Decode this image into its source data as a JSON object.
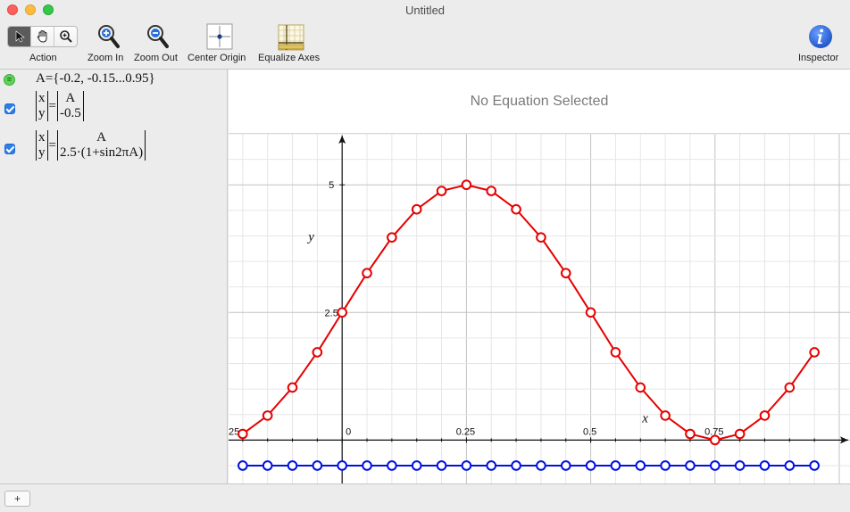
{
  "window": {
    "title": "Untitled"
  },
  "toolbar": {
    "action_label": "Action",
    "zoom_in_label": "Zoom In",
    "zoom_out_label": "Zoom Out",
    "center_origin_label": "Center Origin",
    "equalize_axes_label": "Equalize Axes",
    "inspector_label": "Inspector"
  },
  "sidebar": {
    "definition": "A={-0.2, -0.15...0.95}",
    "eq1": {
      "x": "x",
      "y": "y",
      "top": "A",
      "bottom": "-0.5",
      "checked": true
    },
    "eq2": {
      "x": "x",
      "y": "y",
      "top": "A",
      "bottom": "2.5·(1+sin2πA)",
      "checked": true
    }
  },
  "main": {
    "status": "No Equation Selected"
  },
  "bottombar": {
    "add_label": "+"
  },
  "colors": {
    "curve": "#e60000",
    "points_line": "#0010e0",
    "accent": "#2f7ee6"
  },
  "chart_data": {
    "type": "line",
    "xlabel": "x",
    "ylabel": "y",
    "xlim": [
      -0.25,
      1.0
    ],
    "ylim": [
      -0.85,
      6.0
    ],
    "x_ticks": [
      "25",
      "0",
      "0.25",
      "0.5",
      "0.75"
    ],
    "y_ticks": [
      "5",
      "2.5"
    ],
    "grid": true,
    "series": [
      {
        "color": "#e60000",
        "x": [
          -0.2,
          -0.15,
          -0.1,
          -0.05,
          0,
          0.05,
          0.1,
          0.15,
          0.2,
          0.25,
          0.3,
          0.35,
          0.4,
          0.45,
          0.5,
          0.55,
          0.6,
          0.65,
          0.7,
          0.75,
          0.8,
          0.85,
          0.9,
          0.95
        ],
        "y": [
          0.12,
          0.48,
          1.03,
          1.72,
          2.5,
          3.27,
          3.97,
          4.52,
          4.88,
          5.0,
          4.88,
          4.52,
          3.97,
          3.27,
          2.5,
          1.72,
          1.03,
          0.48,
          0.12,
          0.0,
          0.12,
          0.48,
          1.03,
          1.72
        ]
      },
      {
        "color": "#0010e0",
        "x": [
          -0.2,
          -0.15,
          -0.1,
          -0.05,
          0,
          0.05,
          0.1,
          0.15,
          0.2,
          0.25,
          0.3,
          0.35,
          0.4,
          0.45,
          0.5,
          0.55,
          0.6,
          0.65,
          0.7,
          0.75,
          0.8,
          0.85,
          0.9,
          0.95
        ],
        "y": [
          -0.5,
          -0.5,
          -0.5,
          -0.5,
          -0.5,
          -0.5,
          -0.5,
          -0.5,
          -0.5,
          -0.5,
          -0.5,
          -0.5,
          -0.5,
          -0.5,
          -0.5,
          -0.5,
          -0.5,
          -0.5,
          -0.5,
          -0.5,
          -0.5,
          -0.5,
          -0.5,
          -0.5
        ]
      }
    ]
  }
}
